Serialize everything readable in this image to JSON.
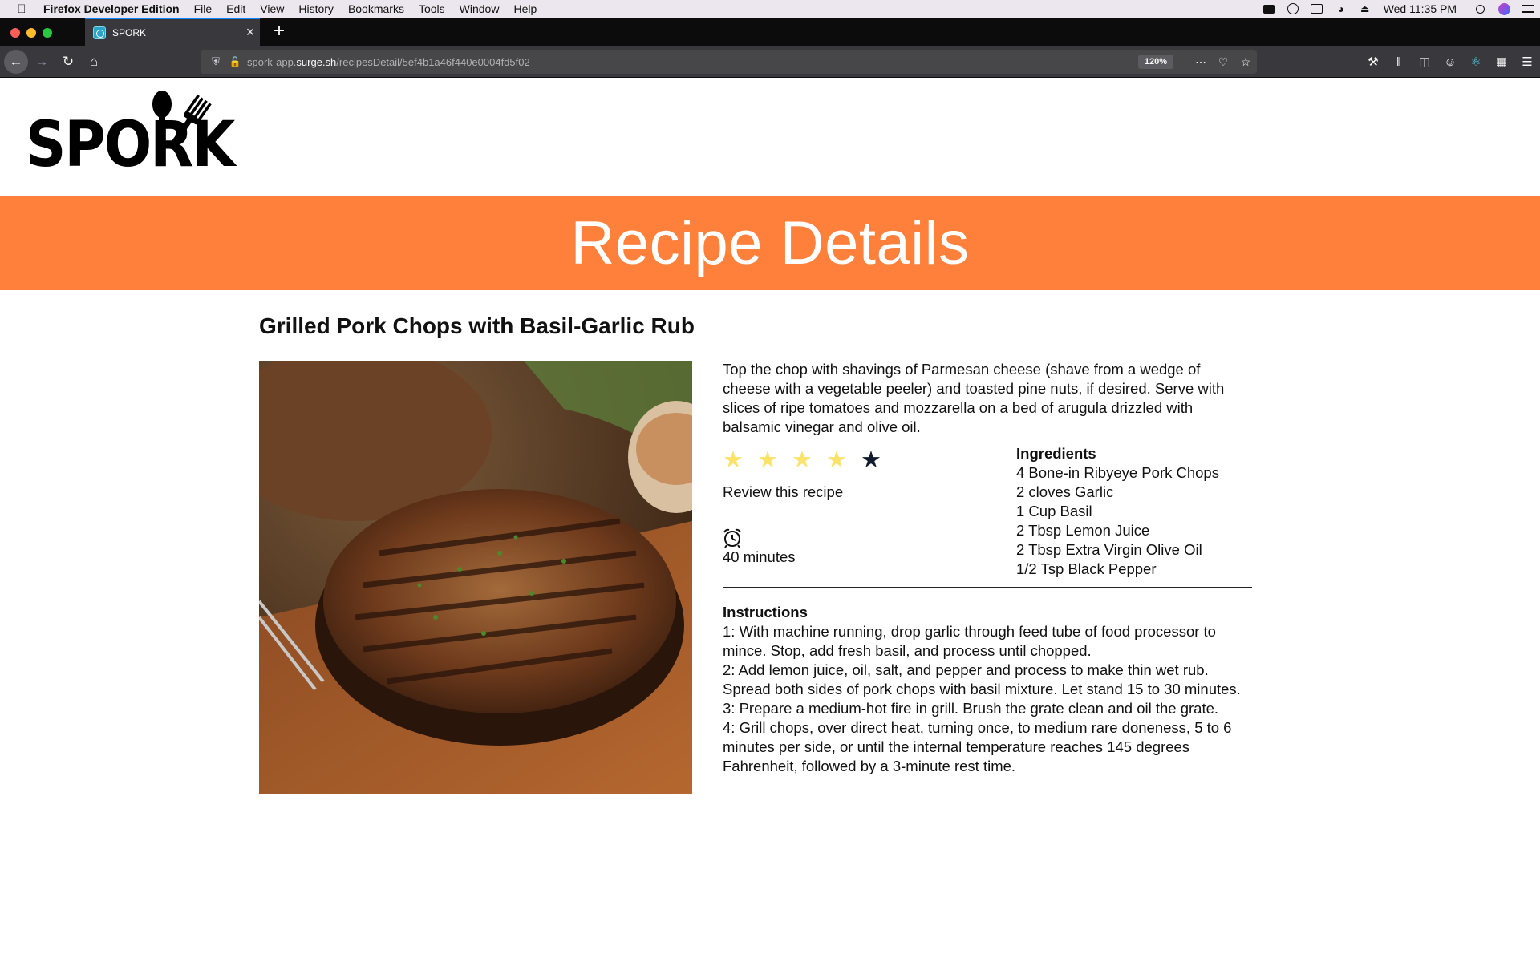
{
  "os_menubar": {
    "app_name": "Firefox Developer Edition",
    "menus": [
      "File",
      "Edit",
      "View",
      "History",
      "Bookmarks",
      "Tools",
      "Window",
      "Help"
    ],
    "clock": "Wed 11:35 PM"
  },
  "browser": {
    "tab_title": "SPORK",
    "url_prefix": "spork-app.",
    "url_host": "surge.sh",
    "url_path": "/recipesDetail/5ef4b1a46f440e0004fd5f02",
    "zoom": "120%"
  },
  "site": {
    "logo_text": "SPORK",
    "banner_title": "Recipe Details"
  },
  "recipe": {
    "title": "Grilled Pork Chops with Basil-Garlic Rub",
    "description": "Top the chop with shavings of Parmesan cheese (shave from a wedge of cheese with a vegetable peeler) and toasted pine nuts, if desired. Serve with slices of ripe tomatoes and mozzarella on a bed of arugula drizzled with balsamic vinegar and olive oil.",
    "rating": 4,
    "rating_max": 5,
    "review_label": "Review this recipe",
    "cook_time": "40 minutes",
    "ingredients_heading": "Ingredients",
    "ingredients": [
      "4 Bone-in Ribyeye Pork Chops",
      "2 cloves Garlic",
      "1 Cup Basil",
      "2 Tbsp Lemon Juice",
      "2 Tbsp Extra Virgin Olive Oil",
      "1/2 Tsp Black Pepper"
    ],
    "instructions_heading": "Instructions",
    "instructions": [
      "1: With machine running, drop garlic through feed tube of food processor to mince. Stop, add fresh basil, and process until chopped.",
      "2: Add lemon juice, oil, salt, and pepper and process to make thin wet rub. Spread both sides of pork chops with basil mixture. Let stand 15 to 30 minutes.",
      "3: Prepare a medium-hot fire in grill. Brush the grate clean and oil the grate.",
      "4: Grill chops, over direct heat, turning once, to medium rare doneness, 5 to 6 minutes per side, or until the internal temperature reaches 145 degrees Fahrenheit, followed by a 3-minute rest time."
    ]
  },
  "colors": {
    "banner": "#fe803b",
    "star_filled": "#fbe26b",
    "star_empty": "#111b2e"
  }
}
